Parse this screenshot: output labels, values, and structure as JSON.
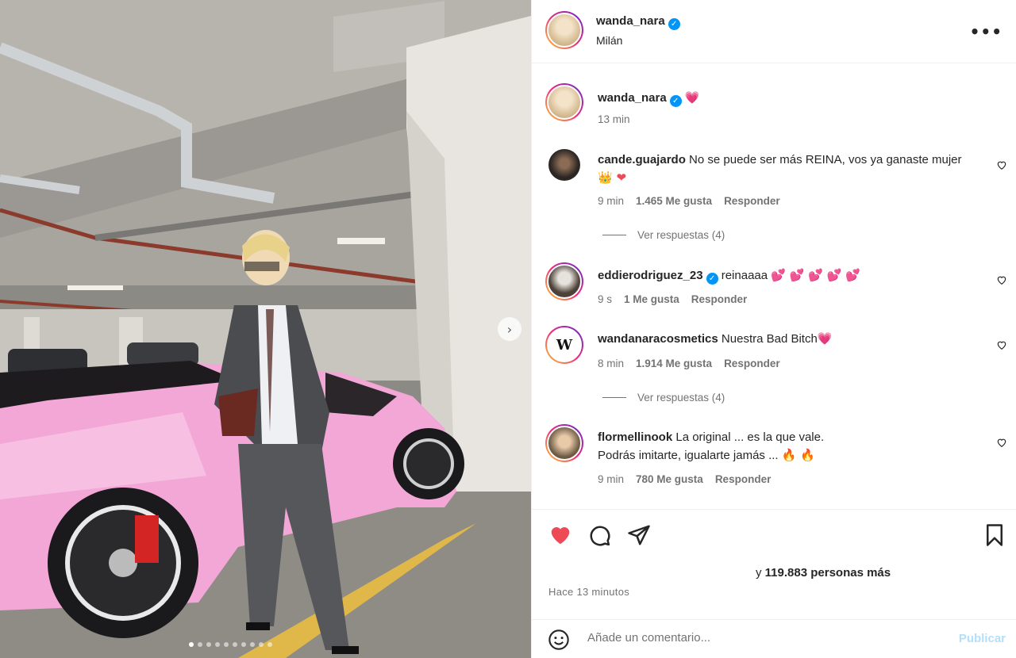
{
  "post": {
    "author": "wanda_nara",
    "location": "Milán",
    "verified": true
  },
  "caption": {
    "username": "wanda_nara",
    "emoji": "💗",
    "time": "13 min"
  },
  "comments": [
    {
      "username": "cande.guajardo",
      "text": "No se puede ser más REINA, vos ya ganaste mujer",
      "emojis": "👑 ❤",
      "time": "9 min",
      "likes": "1.465 Me gusta",
      "reply": "Responder",
      "replies": "Ver respuestas (4)"
    },
    {
      "username": "eddierodriguez_23",
      "verified": true,
      "text": "reinaaaa",
      "emojis": "💕 💕 💕 💕 💕",
      "time": "9 s",
      "likes": "1 Me gusta",
      "reply": "Responder"
    },
    {
      "username": "wandanaracosmetics",
      "text": "Nuestra Bad Bitch",
      "emojis": "💗",
      "time": "8 min",
      "likes": "1.914 Me gusta",
      "reply": "Responder",
      "replies": "Ver respuestas (4)"
    },
    {
      "username": "flormellinook",
      "text": "La original ... es la que vale.",
      "text2": "Podrás imitarte, igualarte jamás ...",
      "emojis": "🔥 🔥",
      "time": "9 min",
      "likes": "780 Me gusta",
      "reply": "Responder"
    }
  ],
  "likes": {
    "prefix": "y",
    "count": "119.883 personas más"
  },
  "timestamp": "Hace 13 minutos",
  "add_comment": {
    "placeholder": "Añade un comentario...",
    "publish": "Publicar"
  },
  "carousel": {
    "total_slides": 10,
    "active_slide": 1
  },
  "colors": {
    "like_red": "#ed4956",
    "verified_blue": "#0095f6",
    "car_pink": "#f2a7d6"
  }
}
